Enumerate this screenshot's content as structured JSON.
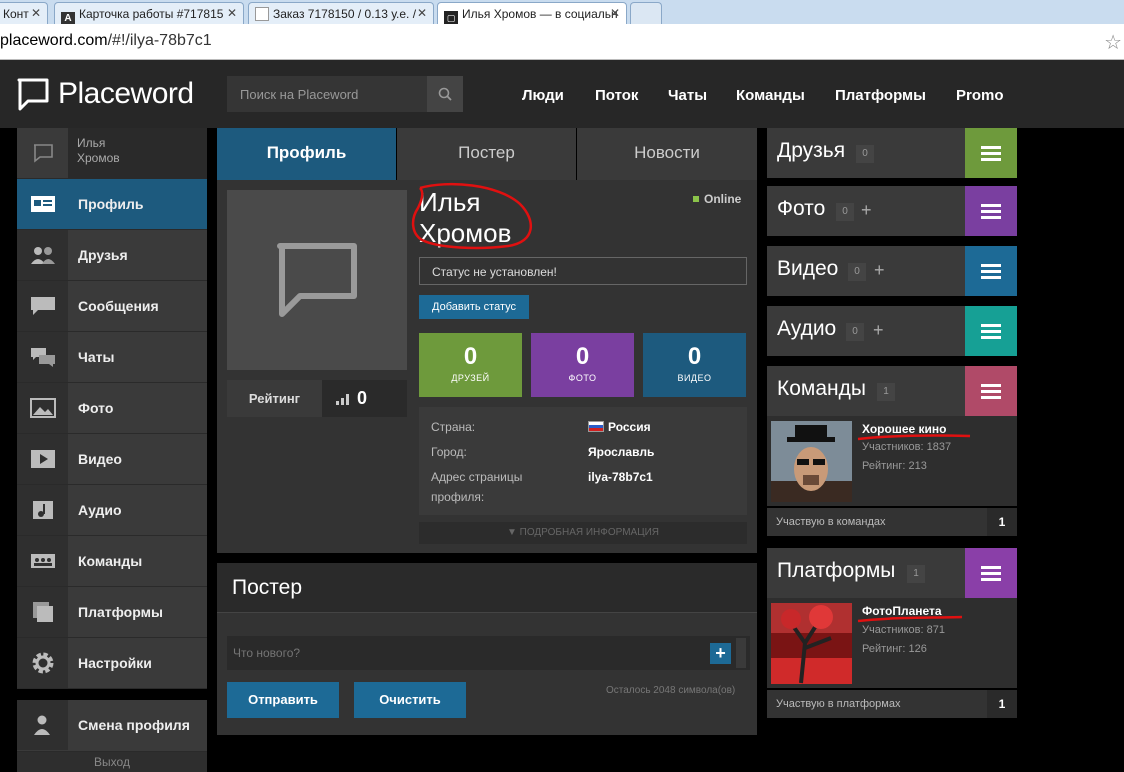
{
  "browser": {
    "tabs": [
      {
        "label": "Конт",
        "favicon": "page-icon"
      },
      {
        "label": "Карточка работы #717815",
        "favicon": "A"
      },
      {
        "label": "Заказ 7178150 / 0.13 у.е. /",
        "favicon": "page-icon"
      },
      {
        "label": "Илья Хромов — в социальн",
        "favicon": "speech-bubble-icon"
      }
    ],
    "url_host": "placeword.com",
    "url_path": "/#!/ilya-78b7c1"
  },
  "header": {
    "logo": "Placeword",
    "search_placeholder": "Поиск на Placeword",
    "nav": [
      "Люди",
      "Поток",
      "Чаты",
      "Команды",
      "Платформы",
      "Promo"
    ]
  },
  "sidebar": {
    "user_name": "Илья Хромов",
    "items": [
      {
        "label": "Профиль",
        "icon": "profile-card-icon"
      },
      {
        "label": "Друзья",
        "icon": "friends-icon"
      },
      {
        "label": "Сообщения",
        "icon": "messages-icon"
      },
      {
        "label": "Чаты",
        "icon": "chats-icon"
      },
      {
        "label": "Фото",
        "icon": "photo-icon"
      },
      {
        "label": "Видео",
        "icon": "video-icon"
      },
      {
        "label": "Аудио",
        "icon": "audio-icon"
      },
      {
        "label": "Команды",
        "icon": "teams-icon"
      },
      {
        "label": "Платформы",
        "icon": "platforms-icon"
      },
      {
        "label": "Настройки",
        "icon": "gear-icon"
      }
    ],
    "switch_profile": "Смена профиля",
    "logout": "Выход"
  },
  "tabs": [
    "Профиль",
    "Постер",
    "Новости"
  ],
  "profile": {
    "name_line1": "Илья",
    "name_line2": "Хромов",
    "online": "Online",
    "status": "Статус не установлен!",
    "add_status": "Добавить статус",
    "rating_label": "Рейтинг",
    "rating_value": "0",
    "stats": [
      {
        "n": "0",
        "label": "ДРУЗЕЙ",
        "color": "#6e9a3c"
      },
      {
        "n": "0",
        "label": "ФОТО",
        "color": "#7a3fa0"
      },
      {
        "n": "0",
        "label": "ВИДЕО",
        "color": "#1d5a7e"
      }
    ],
    "info": [
      {
        "label": "Страна:",
        "value": "Россия"
      },
      {
        "label": "Город:",
        "value": "Ярославль"
      },
      {
        "label": "Адрес страницы профиля:",
        "value": "ilya-78b7c1"
      }
    ],
    "more_info": "ПОДРОБНАЯ ИНФОРМАЦИЯ"
  },
  "poster": {
    "title": "Постер",
    "placeholder": "Что нового?",
    "send": "Отправить",
    "clear": "Очистить",
    "remaining": "Осталось 2048 символа(ов)"
  },
  "right": {
    "friends": {
      "title": "Друзья",
      "count": "0",
      "color": "#6e9a3c"
    },
    "photo": {
      "title": "Фото",
      "count": "0",
      "color": "#7a3fa0"
    },
    "video": {
      "title": "Видео",
      "count": "0",
      "color": "#1d6a96"
    },
    "audio": {
      "title": "Аудио",
      "count": "0",
      "color": "#16a095"
    },
    "teams": {
      "title": "Команды",
      "count": "1",
      "color": "#b04a68",
      "item_name": "Хорошее кино",
      "item_members": "Участников: 1837",
      "item_rating": "Рейтинг: 213",
      "footer": "Участвую в командах",
      "footer_count": "1"
    },
    "platforms": {
      "title": "Платформы",
      "count": "1",
      "color": "#8a3fa8",
      "item_name": "ФотоПланета",
      "item_members": "Участников: 871",
      "item_rating": "Рейтинг: 126",
      "footer": "Участвую в платформах",
      "footer_count": "1"
    }
  }
}
